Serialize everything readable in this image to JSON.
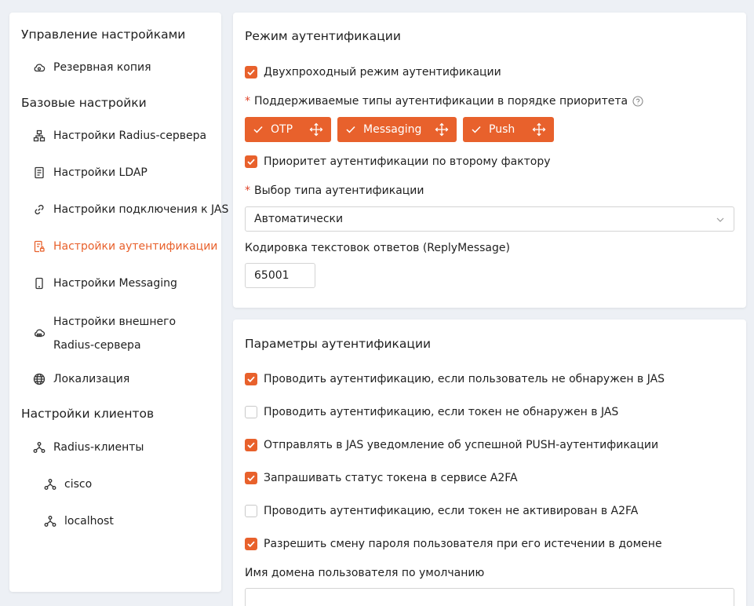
{
  "colors": {
    "accent": "#e8612c",
    "background": "#edf0f5",
    "panel": "#ffffff"
  },
  "sidebar": {
    "sections": [
      {
        "title": "Управление настройками",
        "items": [
          {
            "label": "Резервная копия",
            "icon": "cloud-backup-icon"
          }
        ]
      },
      {
        "title": "Базовые настройки",
        "items": [
          {
            "label": "Настройки Radius-сервера",
            "icon": "server-tree-icon"
          },
          {
            "label": "Настройки LDAP",
            "icon": "document-icon"
          },
          {
            "label": "Настройки подключения к JAS",
            "icon": "link-icon"
          },
          {
            "label": "Настройки аутентификации",
            "icon": "auth-document-icon",
            "active": true
          },
          {
            "label": "Настройки Messaging",
            "icon": "phone-icon"
          },
          {
            "label": "Настройки внешнего Radius-сервера",
            "icon": "cloud-server-icon"
          },
          {
            "label": "Локализация",
            "icon": "globe-icon"
          }
        ]
      },
      {
        "title": "Настройки клиентов",
        "items": [
          {
            "label": "Radius-клиенты",
            "icon": "network-icon"
          },
          {
            "label": "cisco",
            "icon": "network-icon"
          },
          {
            "label": "localhost",
            "icon": "network-icon"
          }
        ]
      }
    ]
  },
  "auth_mode": {
    "title": "Режим аутентификации",
    "two_pass": {
      "label": "Двухпроходный режим аутентификации",
      "checked": true
    },
    "types_label": "Поддерживаемые типы аутентификации в порядке приоритета",
    "required_mark": "*",
    "types": [
      {
        "label": "OTP",
        "checked": true
      },
      {
        "label": "Messaging",
        "checked": true
      },
      {
        "label": "Push",
        "checked": true
      }
    ],
    "second_factor_priority": {
      "label": "Приоритет аутентификации по второму фактору",
      "checked": true
    },
    "auth_type_select_label": "Выбор типа аутентификации",
    "auth_type_value": "Автоматически",
    "encoding_label": "Кодировка текстовок ответов (ReplyMessage)",
    "encoding_value": "65001"
  },
  "auth_params": {
    "title": "Параметры аутентификации",
    "options": [
      {
        "label": "Проводить аутентификацию, если пользователь не обнаружен в JAS",
        "checked": true
      },
      {
        "label": "Проводить аутентификацию, если токен не обнаружен в JAS",
        "checked": false
      },
      {
        "label": "Отправлять в JAS уведомление об успешной PUSH-аутентификации",
        "checked": true
      },
      {
        "label": "Запрашивать статус токена в сервисе A2FA",
        "checked": true
      },
      {
        "label": "Проводить аутентификацию, если токен не активирован в A2FA",
        "checked": false
      },
      {
        "label": "Разрешить смену пароля пользователя при его истечении в домене",
        "checked": true
      }
    ],
    "default_domain_label": "Имя домена пользователя по умолчанию"
  }
}
